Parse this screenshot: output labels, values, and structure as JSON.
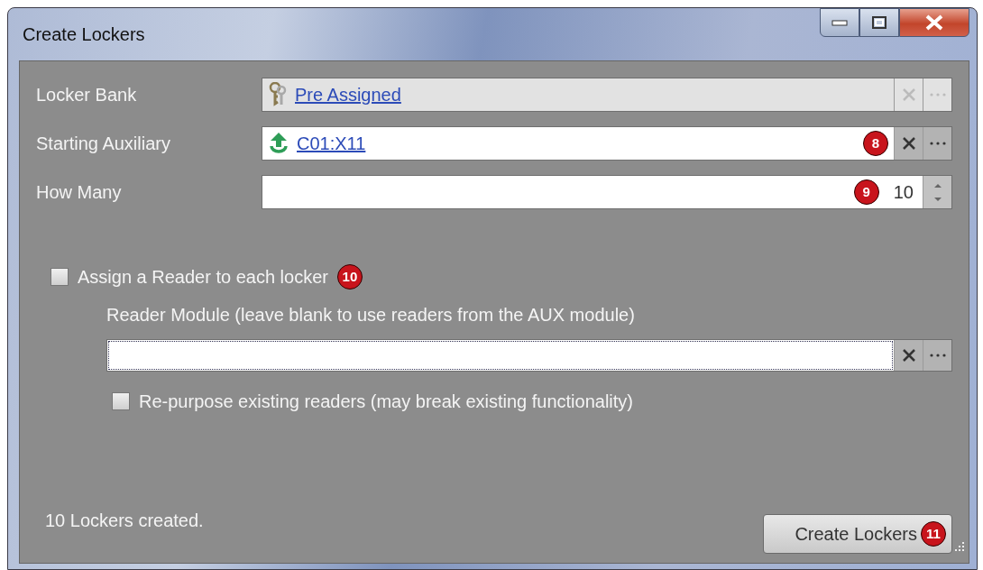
{
  "window": {
    "title": "Create Lockers"
  },
  "fields": [
    {
      "kind": "lookup",
      "label": "Locker Bank",
      "value": "Pre Assigned",
      "disabled": true
    },
    {
      "kind": "lookup",
      "label": "Starting Auxiliary",
      "value": "C01:X11",
      "disabled": false,
      "callout": "8"
    },
    {
      "kind": "spinner",
      "label": "How Many",
      "value": "10",
      "disabled": false,
      "callout": "9"
    }
  ],
  "assign_reader": {
    "label": "Assign a Reader to each locker",
    "checked": false,
    "callout": "10"
  },
  "reader_module": {
    "label": "Reader Module (leave blank to use readers from the AUX module)",
    "disabled": false
  },
  "repurpose": {
    "label": "Re-purpose existing readers (may break existing functionality)",
    "checked": false
  },
  "status": "10 Lockers created.",
  "create_button": {
    "label": "Create Lockers",
    "callout": "11"
  }
}
